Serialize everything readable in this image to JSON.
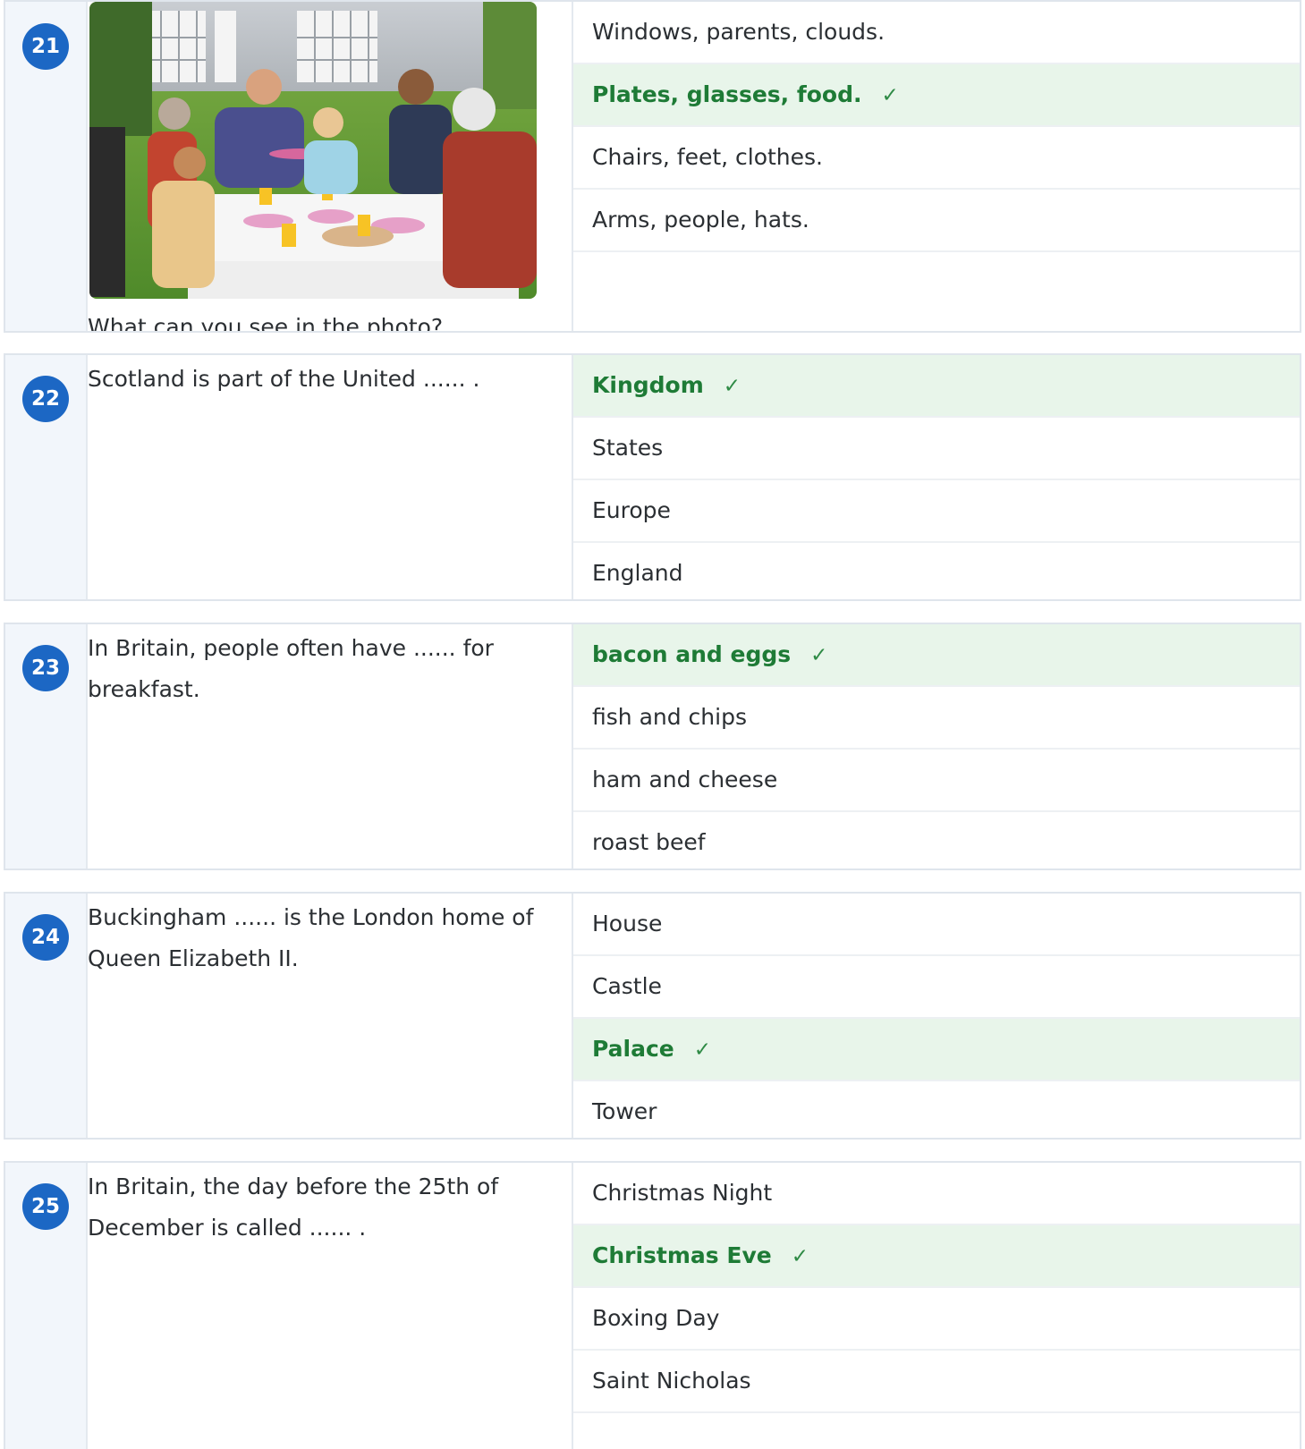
{
  "questions": [
    {
      "number": "21",
      "text": "What can you see in the photo?",
      "has_image": true,
      "options": [
        {
          "label": "Windows, parents, clouds.",
          "correct": false
        },
        {
          "label": "Plates, glasses, food.",
          "correct": true
        },
        {
          "label": "Chairs, feet, clothes.",
          "correct": false
        },
        {
          "label": "Arms, people, hats.",
          "correct": false
        }
      ]
    },
    {
      "number": "22",
      "text": "Scotland is part of the United ...... .",
      "options": [
        {
          "label": "Kingdom",
          "correct": true
        },
        {
          "label": "States",
          "correct": false
        },
        {
          "label": "Europe",
          "correct": false
        },
        {
          "label": "England",
          "correct": false
        }
      ]
    },
    {
      "number": "23",
      "text": "In Britain, people often have ...... for breakfast.",
      "options": [
        {
          "label": "bacon and eggs",
          "correct": true
        },
        {
          "label": "fish and chips",
          "correct": false
        },
        {
          "label": "ham and cheese",
          "correct": false
        },
        {
          "label": "roast beef",
          "correct": false
        }
      ]
    },
    {
      "number": "24",
      "text": "Buckingham ...... is the London home of Queen Elizabeth II.",
      "options": [
        {
          "label": "House",
          "correct": false
        },
        {
          "label": "Castle",
          "correct": false
        },
        {
          "label": "Palace",
          "correct": true
        },
        {
          "label": "Tower",
          "correct": false
        }
      ]
    },
    {
      "number": "25",
      "text": "In Britain, the day before the 25th of December is called ...... .",
      "options": [
        {
          "label": "Christmas Night",
          "correct": false
        },
        {
          "label": "Christmas Eve",
          "correct": true
        },
        {
          "label": "Boxing Day",
          "correct": false
        },
        {
          "label": "Saint Nicholas",
          "correct": false
        }
      ]
    }
  ],
  "check_mark": "✓",
  "colors": {
    "badge": "#1c67c4",
    "correct_bg": "#e8f5ea",
    "correct_text": "#1e7b36",
    "number_column": "#f2f6fb"
  },
  "icons": {
    "check": "check-icon"
  }
}
